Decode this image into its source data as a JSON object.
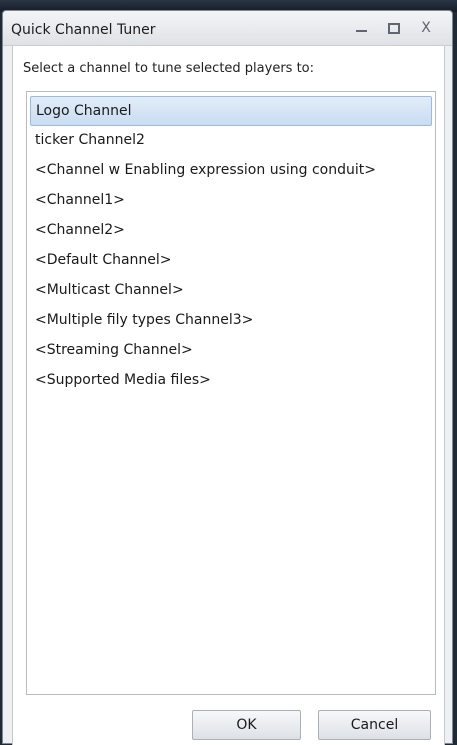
{
  "window": {
    "title": "Quick Channel Tuner",
    "controls": {
      "minimize": "minimize",
      "maximize": "maximize",
      "close": "X"
    }
  },
  "instruction": "Select a channel to tune selected players to:",
  "channels": [
    {
      "label": "Logo Channel",
      "selected": true
    },
    {
      "label": "ticker Channel2"
    },
    {
      "label": "<Channel w Enabling expression using conduit>"
    },
    {
      "label": "<Channel1>"
    },
    {
      "label": "<Channel2>"
    },
    {
      "label": "<Default Channel>"
    },
    {
      "label": "<Multicast Channel>"
    },
    {
      "label": "<Multiple fily types Channel3>"
    },
    {
      "label": "<Streaming Channel>"
    },
    {
      "label": "<Supported Media files>"
    }
  ],
  "buttons": {
    "ok": "OK",
    "cancel": "Cancel"
  },
  "colors": {
    "selection": "#c9dcf1",
    "selection_border": "#9dbbe0",
    "window_bg": "#eef0f3"
  }
}
